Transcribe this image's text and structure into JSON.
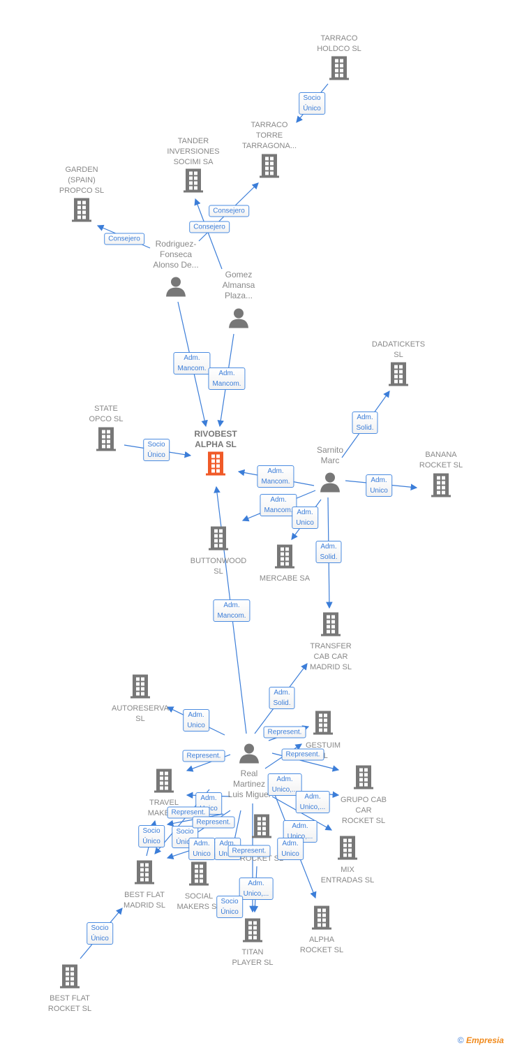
{
  "colors": {
    "accent": "#3b7dd8",
    "focus_node": "#f05a28",
    "node": "#777777"
  },
  "nodes": [
    {
      "id": "tarraco_holdco",
      "label": "TARRACO\nHOLDCO  SL",
      "type": "company"
    },
    {
      "id": "tarraco_torre",
      "label": "TARRACO\nTORRE\nTARRAGONA...",
      "type": "company"
    },
    {
      "id": "tander",
      "label": "TANDER\nINVERSIONES\nSOCIMI SA",
      "type": "company"
    },
    {
      "id": "garden",
      "label": "GARDEN\n(SPAIN)\nPROPCO  SL",
      "type": "company"
    },
    {
      "id": "rodriguez",
      "label": "Rodriguez-\nFonseca\nAlonso De...",
      "type": "person"
    },
    {
      "id": "gomez",
      "label": "Gomez\nAlmansa\nPlaza...",
      "type": "person"
    },
    {
      "id": "dadatickets",
      "label": "DADATICKETS\nSL",
      "type": "company"
    },
    {
      "id": "state",
      "label": "STATE\nOPCO  SL",
      "type": "company"
    },
    {
      "id": "rivobest",
      "label": "RIVOBEST\nALPHA  SL",
      "type": "main"
    },
    {
      "id": "sarnito",
      "label": "Sarnito\nMarc",
      "type": "person"
    },
    {
      "id": "banana",
      "label": "BANANA\nROCKET  SL",
      "type": "company"
    },
    {
      "id": "buttonwood",
      "label": "BUTTONWOOD\nSL",
      "type": "company"
    },
    {
      "id": "mercabe",
      "label": "MERCABE SA",
      "type": "company"
    },
    {
      "id": "transfer",
      "label": "TRANSFER\nCAB CAR\nMADRID  SL",
      "type": "company"
    },
    {
      "id": "autoreserva",
      "label": "AUTORESERVA\nSL",
      "type": "company"
    },
    {
      "id": "gestuim",
      "label": "GESTUIM\nSL",
      "type": "company"
    },
    {
      "id": "real",
      "label": "Real\nMartinez\nLuis Miguel",
      "type": "person"
    },
    {
      "id": "grupo",
      "label": "GRUPO CAB\nCAR\nROCKET  SL",
      "type": "company"
    },
    {
      "id": "travel",
      "label": "TRAVEL\nMAKERS",
      "type": "company"
    },
    {
      "id": "rocket",
      "label": "ROCKET  SL",
      "type": "company"
    },
    {
      "id": "mix",
      "label": "MIX\nENTRADAS  SL",
      "type": "company"
    },
    {
      "id": "bfmadrid",
      "label": "BEST FLAT\nMADRID  SL",
      "type": "company"
    },
    {
      "id": "social",
      "label": "SOCIAL\nMAKERS  SL",
      "type": "company"
    },
    {
      "id": "alpha",
      "label": "ALPHA\nROCKET  SL",
      "type": "company"
    },
    {
      "id": "titan",
      "label": "TITAN\nPLAYER  SL",
      "type": "company"
    },
    {
      "id": "bfrocket",
      "label": "BEST FLAT\nROCKET  SL",
      "type": "company"
    }
  ],
  "edges": [
    {
      "label": "Socio\nÚnico"
    },
    {
      "label": "Consejero"
    },
    {
      "label": "Consejero"
    },
    {
      "label": "Consejero"
    },
    {
      "label": "Adm.\nMancom."
    },
    {
      "label": "Adm.\nMancom."
    },
    {
      "label": "Socio\nÚnico"
    },
    {
      "label": "Adm.\nSolid."
    },
    {
      "label": "Adm.\nUnico"
    },
    {
      "label": "Adm.\nMancom."
    },
    {
      "label": "Adm.\nMancom."
    },
    {
      "label": "Adm.\nUnico"
    },
    {
      "label": "Adm.\nSolid."
    },
    {
      "label": "Adm.\nMancom."
    },
    {
      "label": "Adm.\nSolid."
    },
    {
      "label": "Adm.\nUnico"
    },
    {
      "label": "Represent."
    },
    {
      "label": "Represent."
    },
    {
      "label": "Represent."
    },
    {
      "label": "Adm.\nUnico,..."
    },
    {
      "label": "Adm.\nUnico,..."
    },
    {
      "label": "Adm.\nUnico,..."
    },
    {
      "label": "Adm.\nUnico"
    },
    {
      "label": "Adm.\nUnico"
    },
    {
      "label": "Socio\nÚnico"
    },
    {
      "label": "Socio\nÚnico"
    },
    {
      "label": "Represent."
    },
    {
      "label": "Represent."
    },
    {
      "label": "Adm.\nUnico"
    },
    {
      "label": "Adm.\nUnico"
    },
    {
      "label": "Represent."
    },
    {
      "label": "Adm.\nUnico,..."
    },
    {
      "label": "Socio\nÚnico"
    },
    {
      "label": "Socio\nÚnico"
    }
  ],
  "footer": {
    "copyright": "©",
    "brand": "Empresia"
  }
}
